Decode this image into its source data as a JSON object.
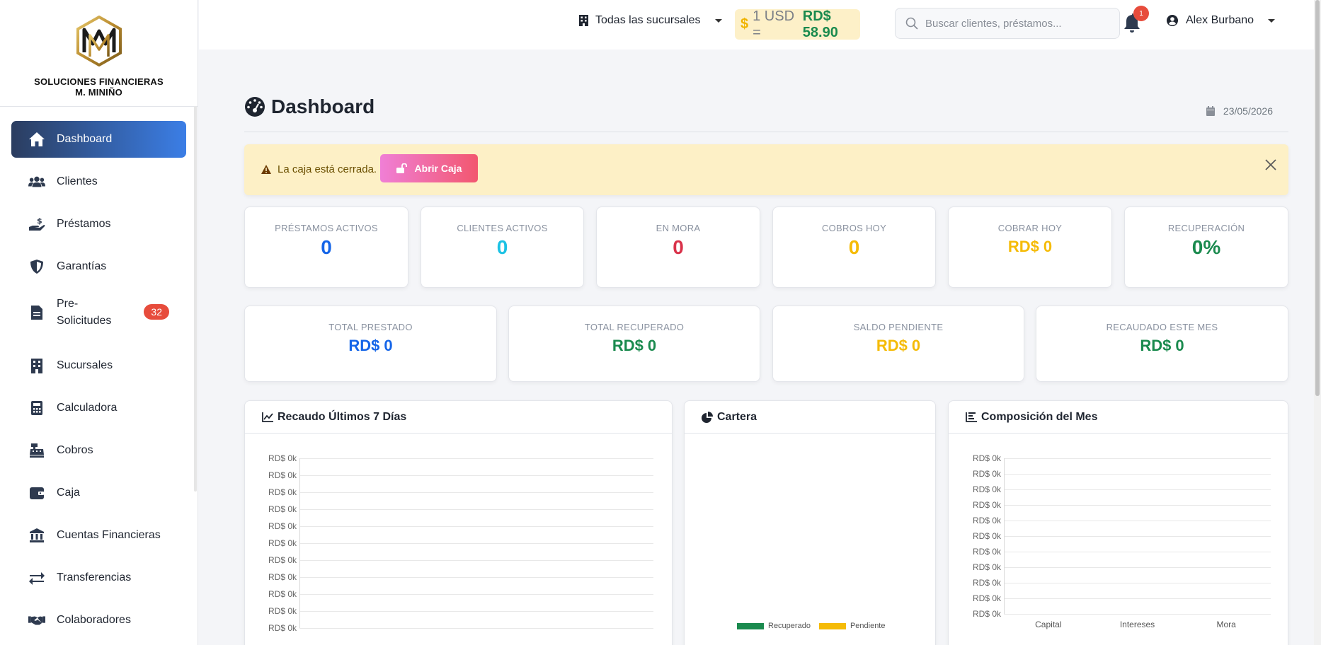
{
  "brand": {
    "line1": "SOLUCIONES FINANCIERAS",
    "line2": "M. MINIÑO"
  },
  "sidebar": {
    "items": [
      {
        "label": "Dashboard",
        "icon": "home-icon",
        "active": true
      },
      {
        "label": "Clientes",
        "icon": "users-icon"
      },
      {
        "label": "Préstamos",
        "icon": "hand-holding-dollar-icon"
      },
      {
        "label": "Garantías",
        "icon": "shield-icon"
      },
      {
        "label": "Pre-Solicitudes",
        "label_line1": "Pre-",
        "label_line2": "Solicitudes",
        "icon": "file-icon",
        "badge": "32"
      },
      {
        "label": "Sucursales",
        "icon": "building-icon"
      },
      {
        "label": "Calculadora",
        "icon": "calculator-icon"
      },
      {
        "label": "Cobros",
        "icon": "cash-register-icon"
      },
      {
        "label": "Caja",
        "icon": "wallet-icon"
      },
      {
        "label": "Cuentas Financieras",
        "icon": "bank-icon"
      },
      {
        "label": "Transferencias",
        "icon": "exchange-icon"
      },
      {
        "label": "Colaboradores",
        "icon": "handshake-icon"
      }
    ]
  },
  "topbar": {
    "branch": "Todas las sucursales",
    "rate": {
      "symbol": "$",
      "usd": "1 USD =",
      "value": "RD$ 58.90"
    },
    "search_placeholder": "Buscar clientes, préstamos...",
    "notifications": "1",
    "user": "Alex Burbano"
  },
  "page": {
    "title": "Dashboard",
    "date": "23/05/2026"
  },
  "alert": {
    "text": "La caja está cerrada.",
    "button": "Abrir Caja"
  },
  "stats": [
    {
      "label": "PRÉSTAMOS ACTIVOS",
      "value": "0",
      "color": "#1565e8"
    },
    {
      "label": "CLIENTES ACTIVOS",
      "value": "0",
      "color": "#1cc2e4"
    },
    {
      "label": "EN MORA",
      "value": "0",
      "color": "#d9324a"
    },
    {
      "label": "COBROS HOY",
      "value": "0",
      "color": "#f5bb07"
    },
    {
      "label": "COBRAR HOY",
      "value": "RD$ 0",
      "color": "#f5bb07"
    },
    {
      "label": "RECUPERACIÓN",
      "value": "0%",
      "color": "#1a8a4e"
    }
  ],
  "totals": [
    {
      "label": "TOTAL PRESTADO",
      "value": "RD$ 0",
      "color": "#1565e8"
    },
    {
      "label": "TOTAL RECUPERADO",
      "value": "RD$ 0",
      "color": "#1a8a4e"
    },
    {
      "label": "SALDO PENDIENTE",
      "value": "RD$ 0",
      "color": "#f5bb07"
    },
    {
      "label": "RECAUDADO ESTE MES",
      "value": "RD$ 0",
      "color": "#1a8a4e"
    }
  ],
  "panels": {
    "recaudo": {
      "title": "Recaudo Últimos 7 Días"
    },
    "cartera": {
      "title": "Cartera"
    },
    "composicion": {
      "title": "Composición del Mes"
    }
  },
  "chart_data": [
    {
      "type": "line",
      "title": "Recaudo Últimos 7 Días",
      "y_tick_labels": [
        "RD$ 0k",
        "RD$ 0k",
        "RD$ 0k",
        "RD$ 0k",
        "RD$ 0k",
        "RD$ 0k",
        "RD$ 0k",
        "RD$ 0k",
        "RD$ 0k",
        "RD$ 0k",
        "RD$ 0k"
      ],
      "x": [],
      "series": []
    },
    {
      "type": "pie",
      "title": "Cartera",
      "legend": [
        {
          "name": "Recuperado",
          "color": "#1a8a4e"
        },
        {
          "name": "Pendiente",
          "color": "#f5bb07"
        }
      ],
      "values": [
        0,
        0
      ]
    },
    {
      "type": "bar",
      "title": "Composición del Mes",
      "categories": [
        "Capital",
        "Intereses",
        "Mora"
      ],
      "values": [
        0,
        0,
        0
      ],
      "y_tick_labels": [
        "RD$ 0k",
        "RD$ 0k",
        "RD$ 0k",
        "RD$ 0k",
        "RD$ 0k",
        "RD$ 0k",
        "RD$ 0k",
        "RD$ 0k",
        "RD$ 0k",
        "RD$ 0k",
        "RD$ 0k"
      ]
    }
  ]
}
